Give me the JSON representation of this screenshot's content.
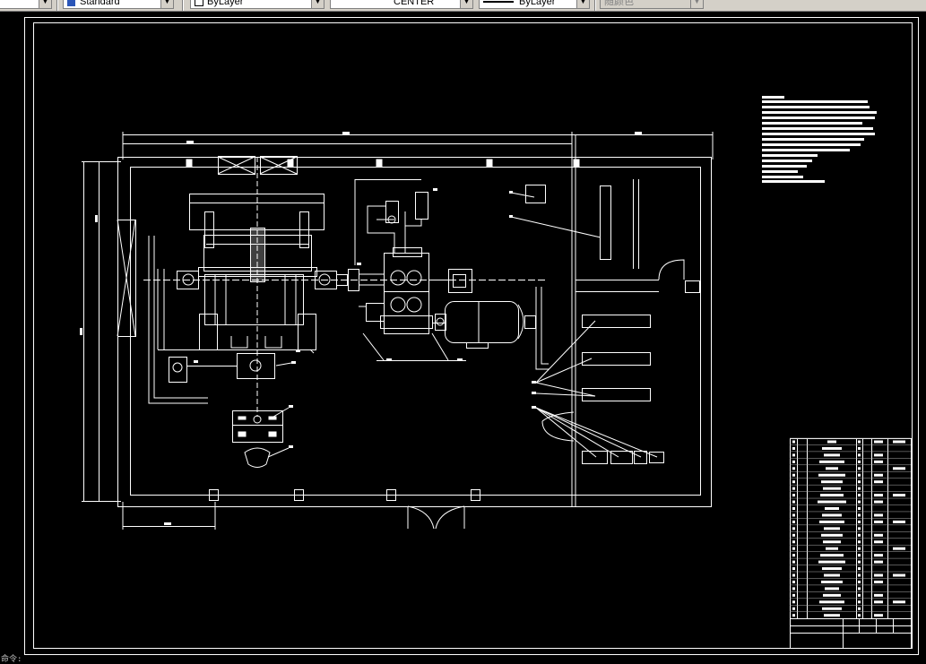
{
  "toolbar": {
    "text_style": "Standard",
    "layer": "ByLayer",
    "linetype": "CENTER",
    "lineweight": "ByLayer",
    "plot_style": "随颜色"
  },
  "colors": {
    "background": "#000000",
    "linework": "#ffffff",
    "toolbar": "#d4d0c8"
  },
  "command_line": {
    "prompt": "命令:"
  }
}
